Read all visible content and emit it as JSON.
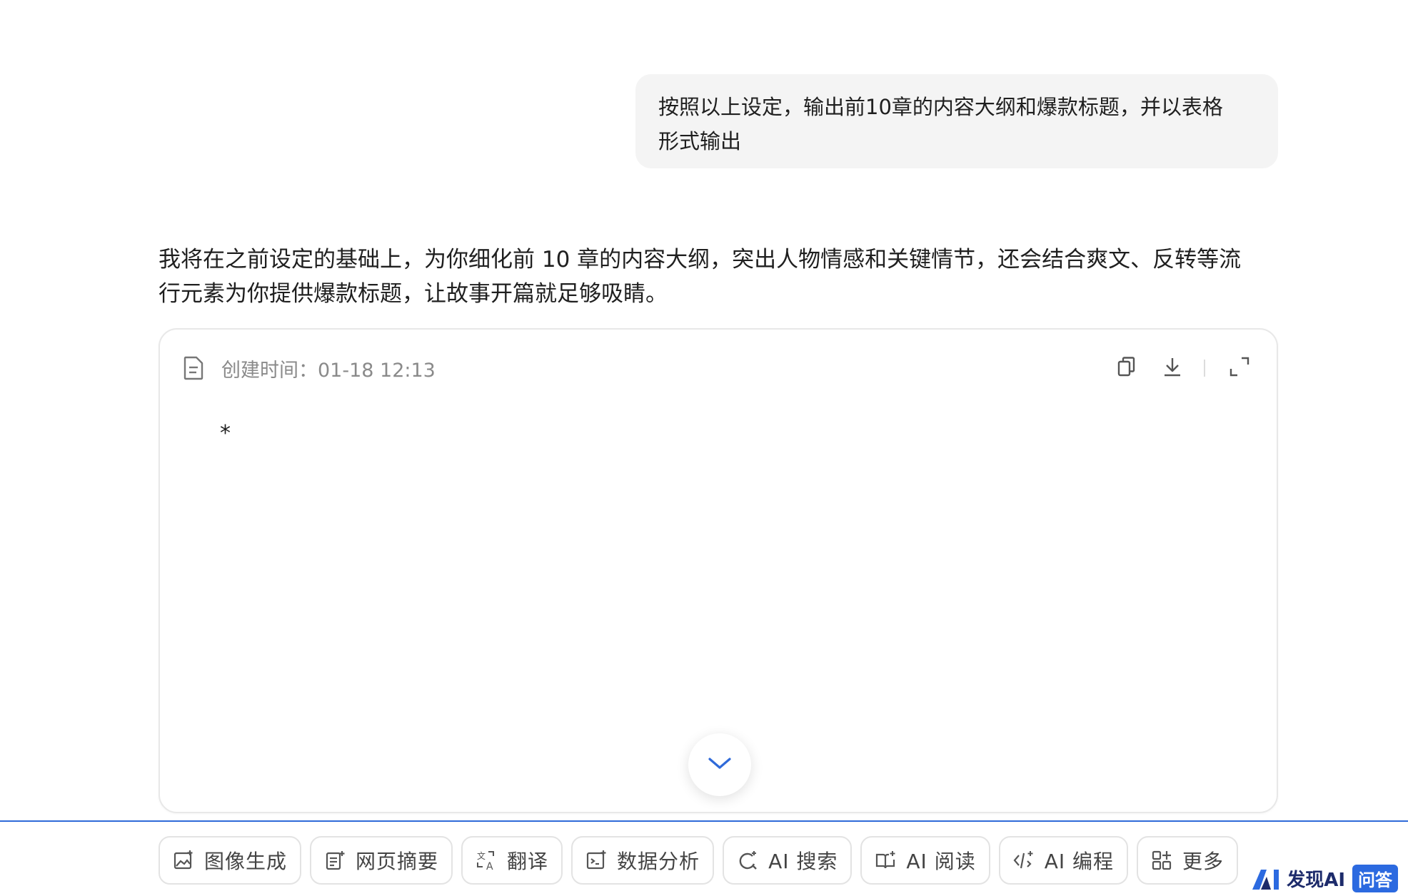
{
  "user_message": {
    "line1": "按照以上设定，输出前10章的内容大纲和爆款标题，并以表格",
    "line2": "形式输出"
  },
  "assistant_message": {
    "line1": "我将在之前设定的基础上，为你细化前 10 章的内容大纲，突出人物情感和关键情节，还会结合爽文、反转等流",
    "line2": "行元素为你提供爆款标题，让故事开篇就足够吸睛。"
  },
  "document": {
    "created_label": "创建时间：",
    "created_time": "01-18 12:13",
    "body_text": "*",
    "icons": [
      "document-icon",
      "copy-icon",
      "download-icon",
      "expand-icon"
    ]
  },
  "scroll_button": {
    "icon": "chevron-down-icon"
  },
  "toolbar": {
    "items": [
      {
        "label": "图像生成",
        "icon": "image-gen-icon"
      },
      {
        "label": "网页摘要",
        "icon": "web-summary-icon"
      },
      {
        "label": "翻译",
        "icon": "translate-icon"
      },
      {
        "label": "数据分析",
        "icon": "data-analysis-icon"
      },
      {
        "label": "AI 搜索",
        "icon": "ai-search-icon"
      },
      {
        "label": "AI 阅读",
        "icon": "ai-read-icon"
      },
      {
        "label": "AI 编程",
        "icon": "ai-code-icon"
      },
      {
        "label": "更多",
        "icon": "more-grid-icon"
      }
    ]
  },
  "watermark": {
    "brand": "发现AI",
    "badge": "问答"
  },
  "colors": {
    "accent": "#2f6ad9",
    "bubble_bg": "#f4f4f4",
    "muted_text": "#8a8a8a"
  }
}
